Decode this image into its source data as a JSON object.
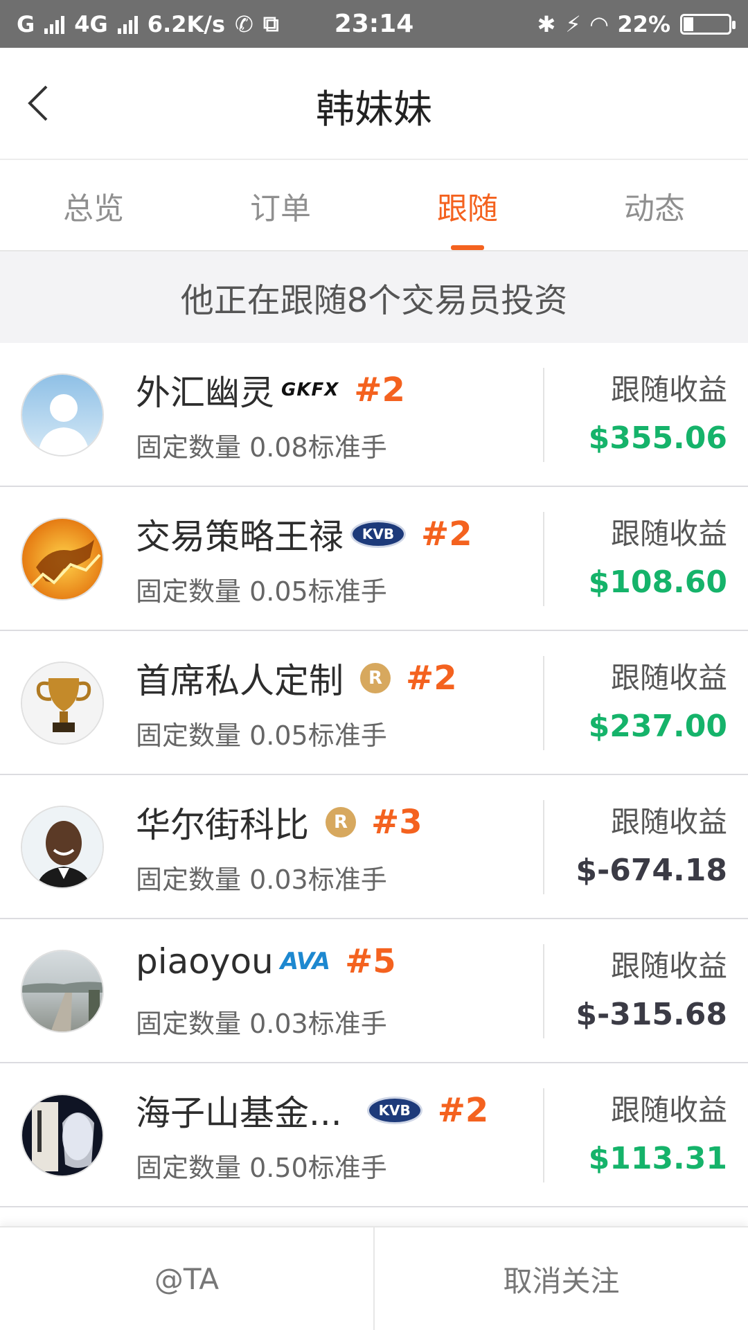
{
  "status_bar": {
    "carrier1": "G",
    "carrier2": "4G",
    "speed": "6.2K/s",
    "time": "23:14",
    "battery": "22%",
    "battery_level": 0.22
  },
  "header": {
    "title": "韩妹妹"
  },
  "tabs": [
    {
      "label": "总览"
    },
    {
      "label": "订单"
    },
    {
      "label": "跟随"
    },
    {
      "label": "动态"
    }
  ],
  "banner": "他正在跟随8个交易员投资",
  "traders": [
    {
      "name": "外汇幽灵",
      "broker": "GKFX",
      "rank": "#2",
      "qty": "固定数量 0.08标准手",
      "profit_label": "跟随收益",
      "profit": "$355.06",
      "profit_positive": true
    },
    {
      "name": "交易策略王禄",
      "broker": "KVB",
      "rank": "#2",
      "qty": "固定数量 0.05标准手",
      "profit_label": "跟随收益",
      "profit": "$108.60",
      "profit_positive": true
    },
    {
      "name": "首席私人定制",
      "broker": "R",
      "rank": "#2",
      "qty": "固定数量 0.05标准手",
      "profit_label": "跟随收益",
      "profit": "$237.00",
      "profit_positive": true
    },
    {
      "name": "华尔街科比",
      "broker": "R",
      "rank": "#3",
      "qty": "固定数量 0.03标准手",
      "profit_label": "跟随收益",
      "profit": "$-674.18",
      "profit_positive": false
    },
    {
      "name": "piaoyou",
      "broker": "AVA",
      "rank": "#5",
      "qty": "固定数量 0.03标准手",
      "profit_label": "跟随收益",
      "profit": "$-315.68",
      "profit_positive": false
    },
    {
      "name": "海子山基金...",
      "broker": "KVB",
      "rank": "#2",
      "qty": "固定数量 0.50标准手",
      "profit_label": "跟随收益",
      "profit": "$113.31",
      "profit_positive": true
    }
  ],
  "bottom": {
    "at_label": "@TA",
    "unfollow_label": "取消关注"
  },
  "colors": {
    "accent": "#f4621f",
    "positive": "#15b36a",
    "negative": "#3b3b45"
  }
}
